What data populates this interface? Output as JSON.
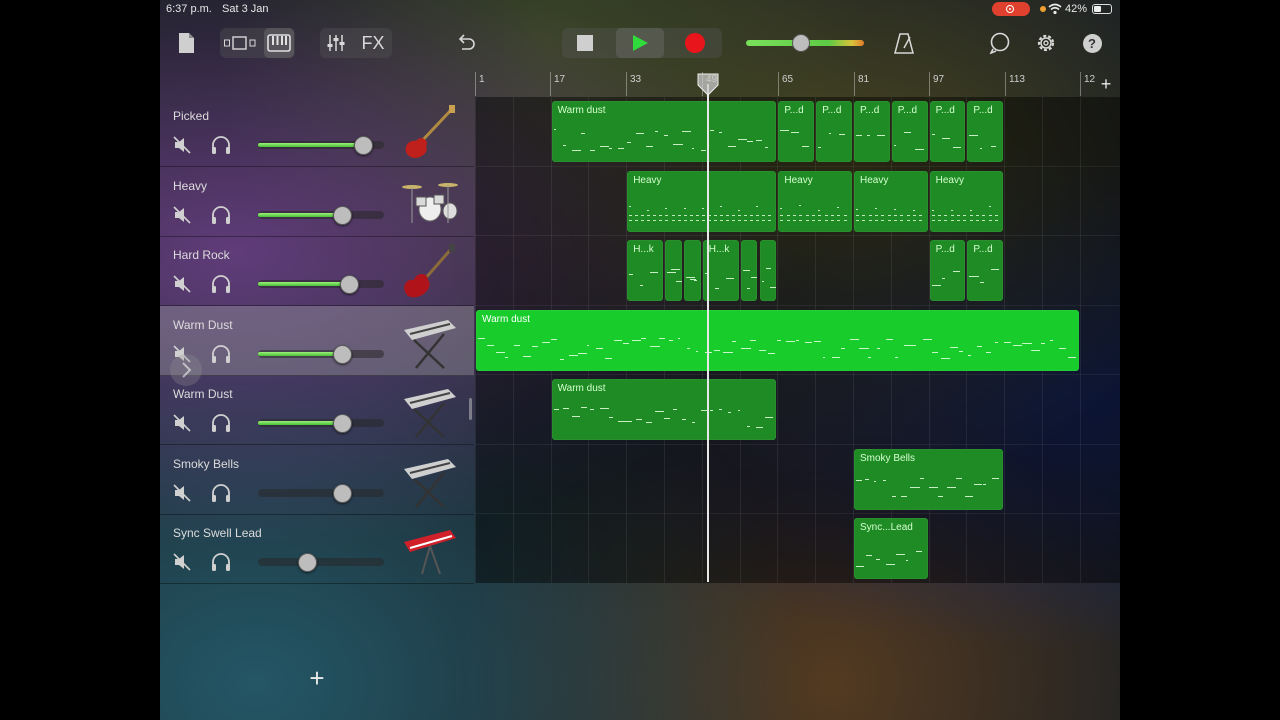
{
  "status_bar": {
    "time": "6:37 p.m.",
    "date": "Sat 3 Jan",
    "battery": "42%"
  },
  "toolbar": {
    "icons": [
      "my-songs-icon",
      "browser-icon",
      "keyboard-icon",
      "mixer-icon",
      "undo-icon",
      "stop-icon",
      "play-icon",
      "record-icon",
      "master-volume",
      "metronome-icon",
      "loop-icon",
      "settings-icon",
      "help-icon"
    ],
    "fx_label": "FX",
    "master_volume_level": 0.5,
    "colors": {
      "play": "#2fdc3c",
      "record": "#e8151c"
    }
  },
  "ruler": {
    "marks": [
      "1",
      "17",
      "33",
      "49",
      "65",
      "81",
      "97",
      "113",
      "12"
    ],
    "add_label": "+"
  },
  "tracks": [
    {
      "name": "Picked",
      "volume": 0.83,
      "instrument": "bass-guitar-icon"
    },
    {
      "name": "Heavy",
      "volume": 0.67,
      "instrument": "drum-kit-icon"
    },
    {
      "name": "Hard Rock",
      "volume": 0.72,
      "instrument": "electric-guitar-icon"
    },
    {
      "name": "Warm Dust",
      "volume": 0.67,
      "instrument": "synth-keyboard-icon"
    },
    {
      "name": "Warm Dust",
      "volume": 0.67,
      "instrument": "synth-keyboard-icon"
    },
    {
      "name": "Smoky Bells",
      "volume": 0.67,
      "instrument": "synth-keyboard-icon"
    },
    {
      "name": "Sync Swell Lead",
      "volume": 0.39,
      "instrument": "red-keyboard-icon"
    }
  ],
  "add_track_label": "+",
  "regions": [
    {
      "track": 0,
      "bars": [
        17,
        65
      ],
      "label": "Warm dust"
    },
    {
      "track": 0,
      "bars": [
        65,
        73
      ],
      "label": "P...d"
    },
    {
      "track": 0,
      "bars": [
        73,
        81
      ],
      "label": "P...d"
    },
    {
      "track": 0,
      "bars": [
        81,
        89
      ],
      "label": "P...d"
    },
    {
      "track": 0,
      "bars": [
        89,
        97
      ],
      "label": "P...d"
    },
    {
      "track": 0,
      "bars": [
        97,
        105
      ],
      "label": "P...d"
    },
    {
      "track": 0,
      "bars": [
        105,
        113
      ],
      "label": "P...d"
    },
    {
      "track": 1,
      "bars": [
        33,
        65
      ],
      "label": "Heavy"
    },
    {
      "track": 1,
      "bars": [
        65,
        81
      ],
      "label": "Heavy"
    },
    {
      "track": 1,
      "bars": [
        81,
        97
      ],
      "label": "Heavy"
    },
    {
      "track": 1,
      "bars": [
        97,
        113
      ],
      "label": "Heavy"
    },
    {
      "track": 2,
      "bars": [
        33,
        41
      ],
      "label": "H...k"
    },
    {
      "track": 2,
      "bars": [
        41,
        45
      ],
      "label": ""
    },
    {
      "track": 2,
      "bars": [
        45,
        49
      ],
      "label": ""
    },
    {
      "track": 2,
      "bars": [
        49,
        57
      ],
      "label": "H...k"
    },
    {
      "track": 2,
      "bars": [
        57,
        61
      ],
      "label": ""
    },
    {
      "track": 2,
      "bars": [
        61,
        65
      ],
      "label": ""
    },
    {
      "track": 2,
      "bars": [
        97,
        105
      ],
      "label": "P...d"
    },
    {
      "track": 2,
      "bars": [
        105,
        113
      ],
      "label": "P...d"
    },
    {
      "track": 3,
      "bars": [
        1,
        129
      ],
      "label": "Warm dust",
      "selected": true
    },
    {
      "track": 4,
      "bars": [
        17,
        65
      ],
      "label": "Warm dust"
    },
    {
      "track": 5,
      "bars": [
        81,
        113
      ],
      "label": "Smoky Bells"
    },
    {
      "track": 6,
      "bars": [
        81,
        97
      ],
      "label": "Sync...Lead"
    }
  ],
  "playhead_bar": 49
}
